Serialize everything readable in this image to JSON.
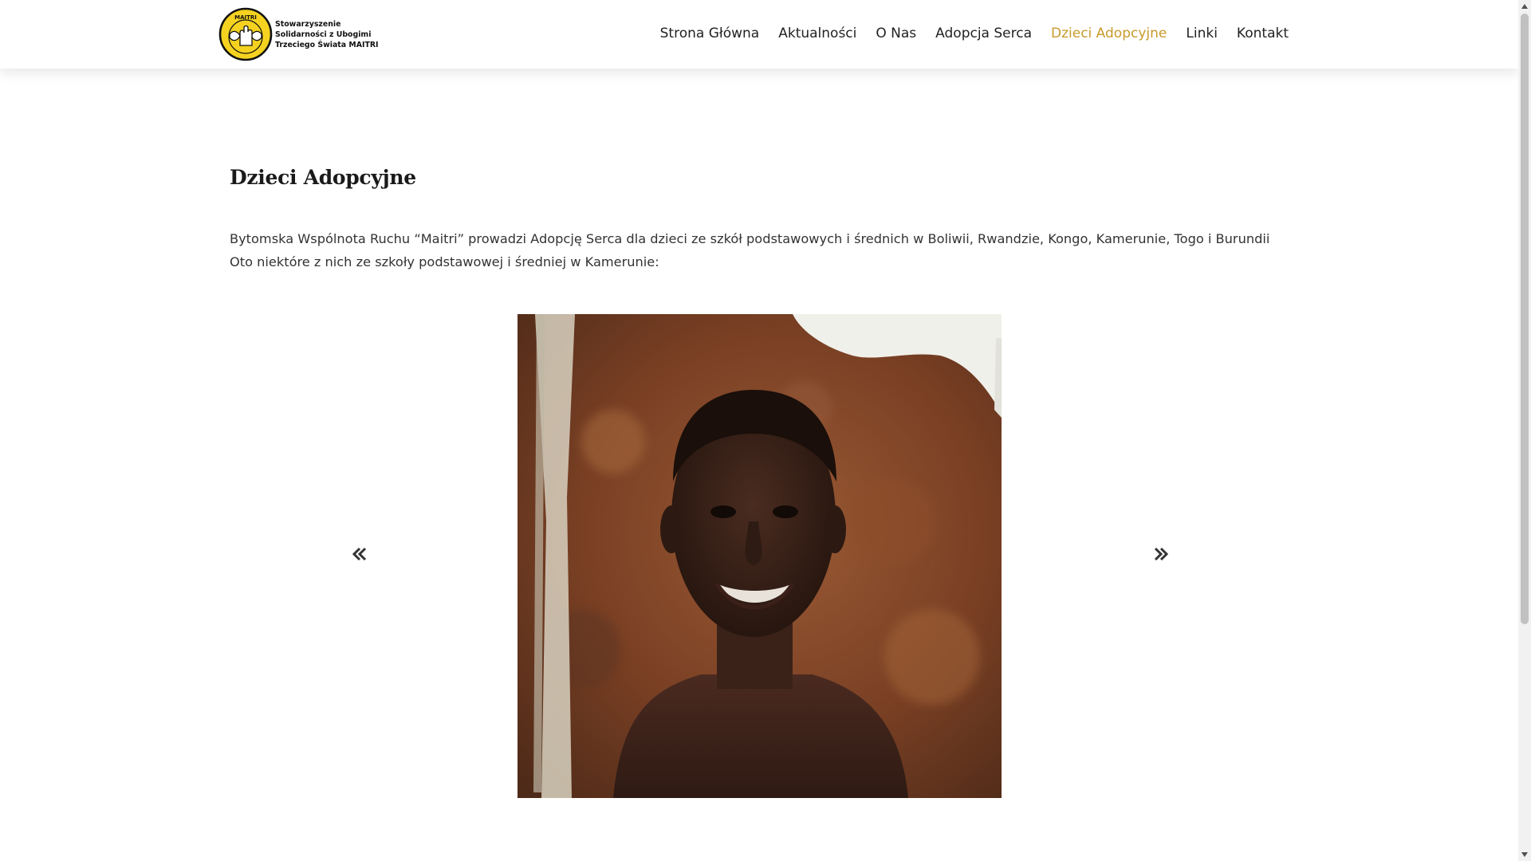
{
  "header": {
    "logo": {
      "badge_text": "MAITRI",
      "lines": [
        "Stowarzyszenie",
        "Solidarności z Ubogimi",
        "Trzeciego Świata MAITRI"
      ]
    },
    "nav": [
      {
        "label": "Strona Główna",
        "active": false
      },
      {
        "label": "Aktualności",
        "active": false
      },
      {
        "label": "O Nas",
        "active": false
      },
      {
        "label": "Adopcja Serca",
        "active": false
      },
      {
        "label": "Dzieci Adopcyjne",
        "active": true
      },
      {
        "label": "Linki",
        "active": false
      },
      {
        "label": "Kontakt",
        "active": false
      }
    ]
  },
  "main": {
    "title": "Dzieci Adopcyjne",
    "intro": "Bytomska Wspólnota Ruchu “Maitri” prowadzi Adopcję Serca dla dzieci ze szkół podstawowych i średnich w Boliwii, Rwandzie, Kongo, Kamerunie, Togo i Burundii Oto niektóre z nich ze szkoły podstawowej i średniej w Kamerunie:",
    "slider": {
      "prev_icon": "double-chevron-left-icon",
      "next_icon": "double-chevron-right-icon"
    }
  },
  "colors": {
    "accent": "#c89a2a",
    "logo_yellow": "#f4d21f",
    "text": "#333333"
  }
}
